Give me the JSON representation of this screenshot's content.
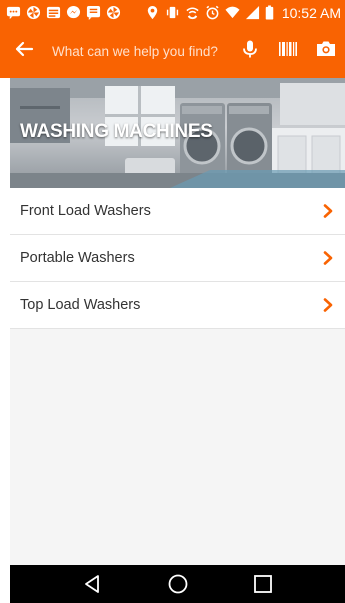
{
  "status_bar": {
    "time": "10:52 AM",
    "notification_icons": [
      "message-icon",
      "pinwheel-icon",
      "news-icon",
      "messenger-icon",
      "chat-icon",
      "pinwheel-icon"
    ],
    "system_icons": [
      "location-icon",
      "vibrate-icon",
      "wifi-calling-icon",
      "alarm-icon",
      "wifi-icon",
      "signal-icon",
      "battery-icon"
    ]
  },
  "app_bar": {
    "search_placeholder": "What can we help you find?",
    "icons": [
      "back-arrow-icon",
      "microphone-icon",
      "barcode-icon",
      "camera-icon"
    ],
    "accent_color": "#f96302"
  },
  "banner": {
    "title": "WASHING MACHINES"
  },
  "categories": [
    {
      "label": "Front Load Washers"
    },
    {
      "label": "Portable Washers"
    },
    {
      "label": "Top Load Washers"
    }
  ],
  "nav_bar": {
    "icons": [
      "back-triangle-icon",
      "home-circle-icon",
      "recents-square-icon"
    ]
  }
}
